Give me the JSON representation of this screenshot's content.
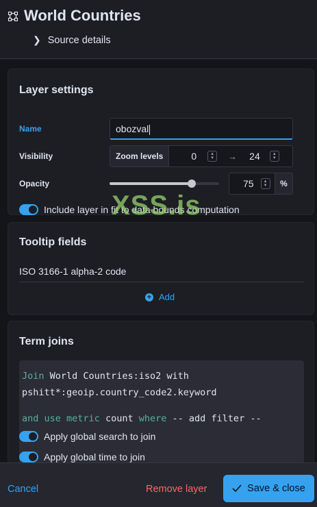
{
  "header": {
    "title": "World Countries",
    "source_details_label": "Source details",
    "layer_icon": "vector-layer-icon"
  },
  "layer_settings": {
    "title": "Layer settings",
    "name_label": "Name",
    "name_value": "obozval",
    "visibility_label": "Visibility",
    "zoom_levels_label": "Zoom levels",
    "zoom_min": "0",
    "zoom_max": "24",
    "opacity_label": "Opacity",
    "opacity_value": "75",
    "opacity_unit": "%",
    "fit_to_bounds_label": "Include layer in fit to data bounds computation",
    "fit_to_bounds_on": true
  },
  "tooltip_fields": {
    "title": "Tooltip fields",
    "fields": [
      "ISO 3166-1 alpha-2 code"
    ],
    "add_label": "Add"
  },
  "term_joins": {
    "title": "Term joins",
    "join_kw": "Join",
    "join_left": "World Countries:iso2",
    "with_kw": "with",
    "join_right": "pshitt*:geoip.country_code2.keyword",
    "and_use_kw": "and use",
    "metric_kw": "metric",
    "metric_value": "count",
    "where_kw": "where",
    "filter_value": "-- add filter --",
    "global_search_label": "Apply global search to join",
    "global_time_label": "Apply global time to join"
  },
  "footer": {
    "cancel_label": "Cancel",
    "remove_label": "Remove layer",
    "save_label": "Save & close"
  },
  "watermark": "XSS.is",
  "colors": {
    "accent": "#36a2ef",
    "danger": "#ff6666",
    "keyword": "#54b399"
  },
  "opacity_fraction": 0.75
}
